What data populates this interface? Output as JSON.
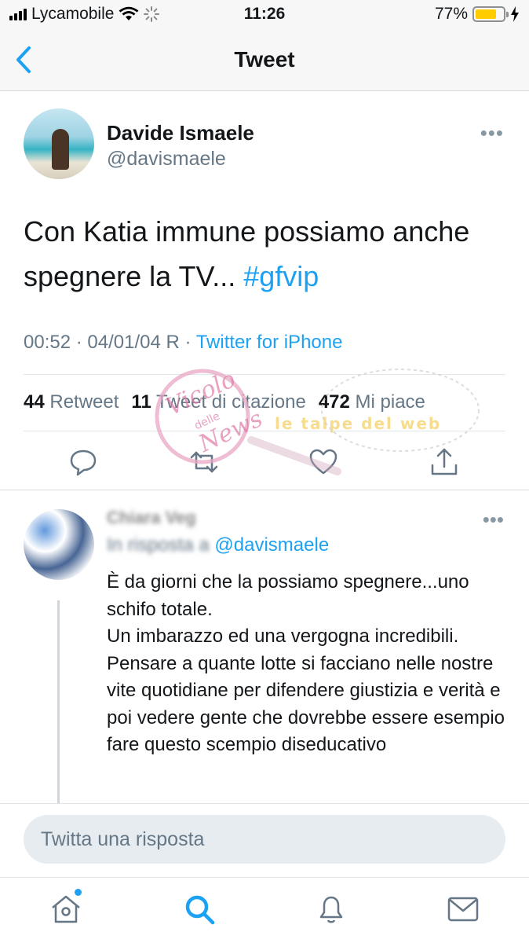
{
  "status_bar": {
    "carrier": "Lycamobile",
    "time": "11:26",
    "battery": "77%",
    "battery_level": 0.77
  },
  "nav": {
    "title": "Tweet",
    "back_icon": "chevron-left-icon"
  },
  "tweet": {
    "author_name": "Davide Ismaele",
    "author_handle": "@davismaele",
    "text": "Con Katia immune possiamo anche spegnere la TV...",
    "hashtag": "#gfvip",
    "time_date": "00:52 · 04/01/04 R ·",
    "client": "Twitter for iPhone",
    "stats": {
      "retweets_count": "44",
      "retweets_label": "Retweet",
      "quotes_count": "11",
      "quotes_label": "Tweet di citazione",
      "likes_count": "472",
      "likes_label": "Mi piace"
    }
  },
  "watermark": {
    "text_1": "Vicolo",
    "text_2": "delle",
    "text_3": "News",
    "text_4": "le talpe del web"
  },
  "reply": {
    "name": "Chiara Veg",
    "reply_prefix": "In risposta a",
    "mention": "@davismaele",
    "lines": [
      "È da giorni che la possiamo spegnere...uno schifo totale.",
      "Un imbarazzo ed una vergogna incredibili. Pensare a quante lotte si facciano nelle nostre vite quotidiane per difendere giustizia e verità e poi vedere gente che dovrebbe essere esempio fare questo scempio diseducativo"
    ]
  },
  "composer": {
    "placeholder": "Twitta una risposta"
  },
  "colors": {
    "accent": "#1da1f2",
    "secondary_text": "#657786",
    "battery": "#ffcc00"
  }
}
